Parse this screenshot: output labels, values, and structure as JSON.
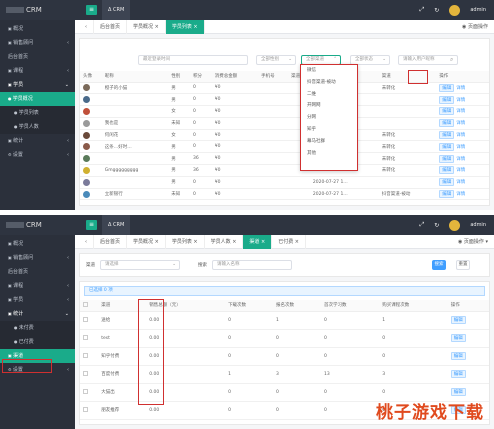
{
  "panel1": {
    "brand": "CRM",
    "app_tab": "CRM",
    "user": "admin",
    "sidebar": [
      {
        "label": "概况",
        "icon": "dashboard-icon",
        "state": "normal"
      },
      {
        "label": "销售顾问",
        "icon": "user-icon",
        "state": "normal",
        "arrow": "‹"
      },
      {
        "label": "后台首页",
        "icon": "",
        "state": "normal"
      },
      {
        "label": "课程",
        "icon": "book-icon",
        "state": "normal",
        "arrow": "‹"
      },
      {
        "label": "学员",
        "icon": "student-icon",
        "state": "expanded",
        "arrow": "⌄"
      },
      {
        "label": "学员概况",
        "icon": "circle-icon",
        "state": "active"
      },
      {
        "label": "学员列表",
        "icon": "circle-icon",
        "state": "sub"
      },
      {
        "label": "学员人数",
        "icon": "circle-icon",
        "state": "sub"
      },
      {
        "label": "统计",
        "icon": "chart-icon",
        "state": "normal",
        "arrow": "‹"
      },
      {
        "label": "设置",
        "icon": "gear-icon",
        "state": "normal",
        "arrow": "‹"
      }
    ],
    "tabs": [
      {
        "label": "后台首页",
        "active": false
      },
      {
        "label": "学员概况",
        "active": false
      },
      {
        "label": "学员列表",
        "active": true
      }
    ],
    "tab_right": "◉ 页面操作",
    "filters": {
      "date": "最近登录时间",
      "gender": "全部性别",
      "channel": "全部渠道",
      "status": "全部状态",
      "search": "请输入用户昵称"
    },
    "channel_options": [
      "微信",
      "抖音渠道-被动",
      "二维",
      "开网网",
      "分网",
      "知乎",
      "幕马社群",
      "其他"
    ],
    "columns": [
      "头像",
      "昵称",
      "性别",
      "积分",
      "消费总金额",
      "手机号",
      "渠道",
      "最后登录时间",
      "渠道",
      "操作"
    ],
    "rows": [
      {
        "nick": "橙子的小猫",
        "gender": "男",
        "points": "0",
        "amount": "¥0",
        "mobile": "",
        "time": "2020-07-29 1…",
        "ch": "未转化",
        "c": "#7b6a5a"
      },
      {
        "nick": "",
        "gender": "男",
        "points": "0",
        "amount": "¥0",
        "mobile": "",
        "time": "2020-07-28 1…",
        "ch": "",
        "c": "#4a6a8a"
      },
      {
        "nick": "",
        "gender": "女",
        "points": "0",
        "amount": "¥0",
        "mobile": "",
        "time": "2020-07-28 1…",
        "ch": "",
        "c": "#c0503a"
      },
      {
        "nick": "我也是",
        "gender": "未知",
        "points": "0",
        "amount": "¥0",
        "mobile": "",
        "time": "2020-07-28 1…",
        "ch": "",
        "c": "#9a9a9a"
      },
      {
        "nick": "何闲花",
        "gender": "女",
        "points": "0",
        "amount": "¥0",
        "mobile": "",
        "time": "2020-07-28 1…",
        "ch": "未转化",
        "c": "#6a4a3a"
      },
      {
        "nick": "这条…好时…",
        "gender": "男",
        "points": "0",
        "amount": "¥0",
        "mobile": "",
        "time": "2020-07-27 1…",
        "ch": "未转化",
        "c": "#8a5a4a"
      },
      {
        "nick": "",
        "gender": "男",
        "points": "36",
        "amount": "¥0",
        "mobile": "",
        "time": "2020-07-27 1…",
        "ch": "未转化",
        "c": "#5a7a5a"
      },
      {
        "nick": "Gmggggggggg",
        "gender": "男",
        "points": "36",
        "amount": "¥0",
        "mobile": "",
        "time": "2020-07-27 1…",
        "ch": "未转化",
        "c": "#d0b030"
      },
      {
        "nick": "",
        "gender": "男",
        "points": "0",
        "amount": "¥0",
        "mobile": "",
        "time": "2020-07-27 1…",
        "ch": "",
        "c": "#7a7a9a"
      },
      {
        "nick": "立新银行",
        "gender": "未知",
        "points": "0",
        "amount": "¥0",
        "mobile": "",
        "time": "2020-07-27 1…",
        "ch": "抖音渠道-被动",
        "c": "#4a8aba"
      }
    ],
    "ok_label": "编辑",
    "detail_label": "详情"
  },
  "panel2": {
    "brand": "CRM",
    "app_tab": "CRM",
    "user": "admin",
    "sidebar": [
      {
        "label": "概况",
        "icon": "dashboard-icon",
        "state": "normal"
      },
      {
        "label": "销售顾问",
        "icon": "user-icon",
        "state": "normal",
        "arrow": "‹"
      },
      {
        "label": "后台首页",
        "icon": "",
        "state": "normal"
      },
      {
        "label": "课程",
        "icon": "book-icon",
        "state": "normal",
        "arrow": "‹"
      },
      {
        "label": "学员",
        "icon": "student-icon",
        "state": "normal",
        "arrow": "‹"
      },
      {
        "label": "统计",
        "icon": "chart-icon",
        "state": "expanded",
        "arrow": "⌄"
      },
      {
        "label": "未付费",
        "icon": "circle-icon",
        "state": "sub"
      },
      {
        "label": "已付费",
        "icon": "circle-icon",
        "state": "sub"
      },
      {
        "label": "渠道",
        "icon": "list-icon",
        "state": "active"
      },
      {
        "label": "设置",
        "icon": "gear-icon",
        "state": "normal",
        "arrow": "‹"
      }
    ],
    "tabs": [
      {
        "label": "后台首页",
        "active": false
      },
      {
        "label": "学员概况",
        "active": false
      },
      {
        "label": "学员列表",
        "active": false
      },
      {
        "label": "学员人数",
        "active": false
      },
      {
        "label": "渠道",
        "active": true
      },
      {
        "label": "已付费",
        "active": false
      }
    ],
    "tab_right": "◉ 页面操作 ▾",
    "filters": {
      "channel_label": "渠道",
      "channel_placeholder": "请选择",
      "keyword_label": "搜索",
      "keyword_placeholder": "请输入名称",
      "search_btn": "搜索",
      "reset_btn": "重置"
    },
    "selected_info": "已选择 0 项",
    "columns": [
      "",
      "渠道",
      "销售总额（元）",
      "下载次数",
      "报名次数",
      "首次学习数",
      "购买课程次数",
      "操作"
    ],
    "rows": [
      {
        "name": "送给",
        "amount": "0.00",
        "a": "0",
        "b": "1",
        "c": "0",
        "d": "1"
      },
      {
        "name": "test",
        "amount": "0.00",
        "a": "0",
        "b": "0",
        "c": "0",
        "d": "0"
      },
      {
        "name": "知乎付费",
        "amount": "0.00",
        "a": "0",
        "b": "0",
        "c": "0",
        "d": "0"
      },
      {
        "name": "百度付费",
        "amount": "0.00",
        "a": "1",
        "b": "3",
        "c": "13",
        "d": "3"
      },
      {
        "name": "大猫出",
        "amount": "0.00",
        "a": "0",
        "b": "0",
        "c": "0",
        "d": "0"
      },
      {
        "name": "朋友推荐",
        "amount": "0.00",
        "a": "0",
        "b": "0",
        "c": "0",
        "d": "0"
      }
    ],
    "edit_label": "编辑"
  },
  "watermark": "桃子游戏下载"
}
